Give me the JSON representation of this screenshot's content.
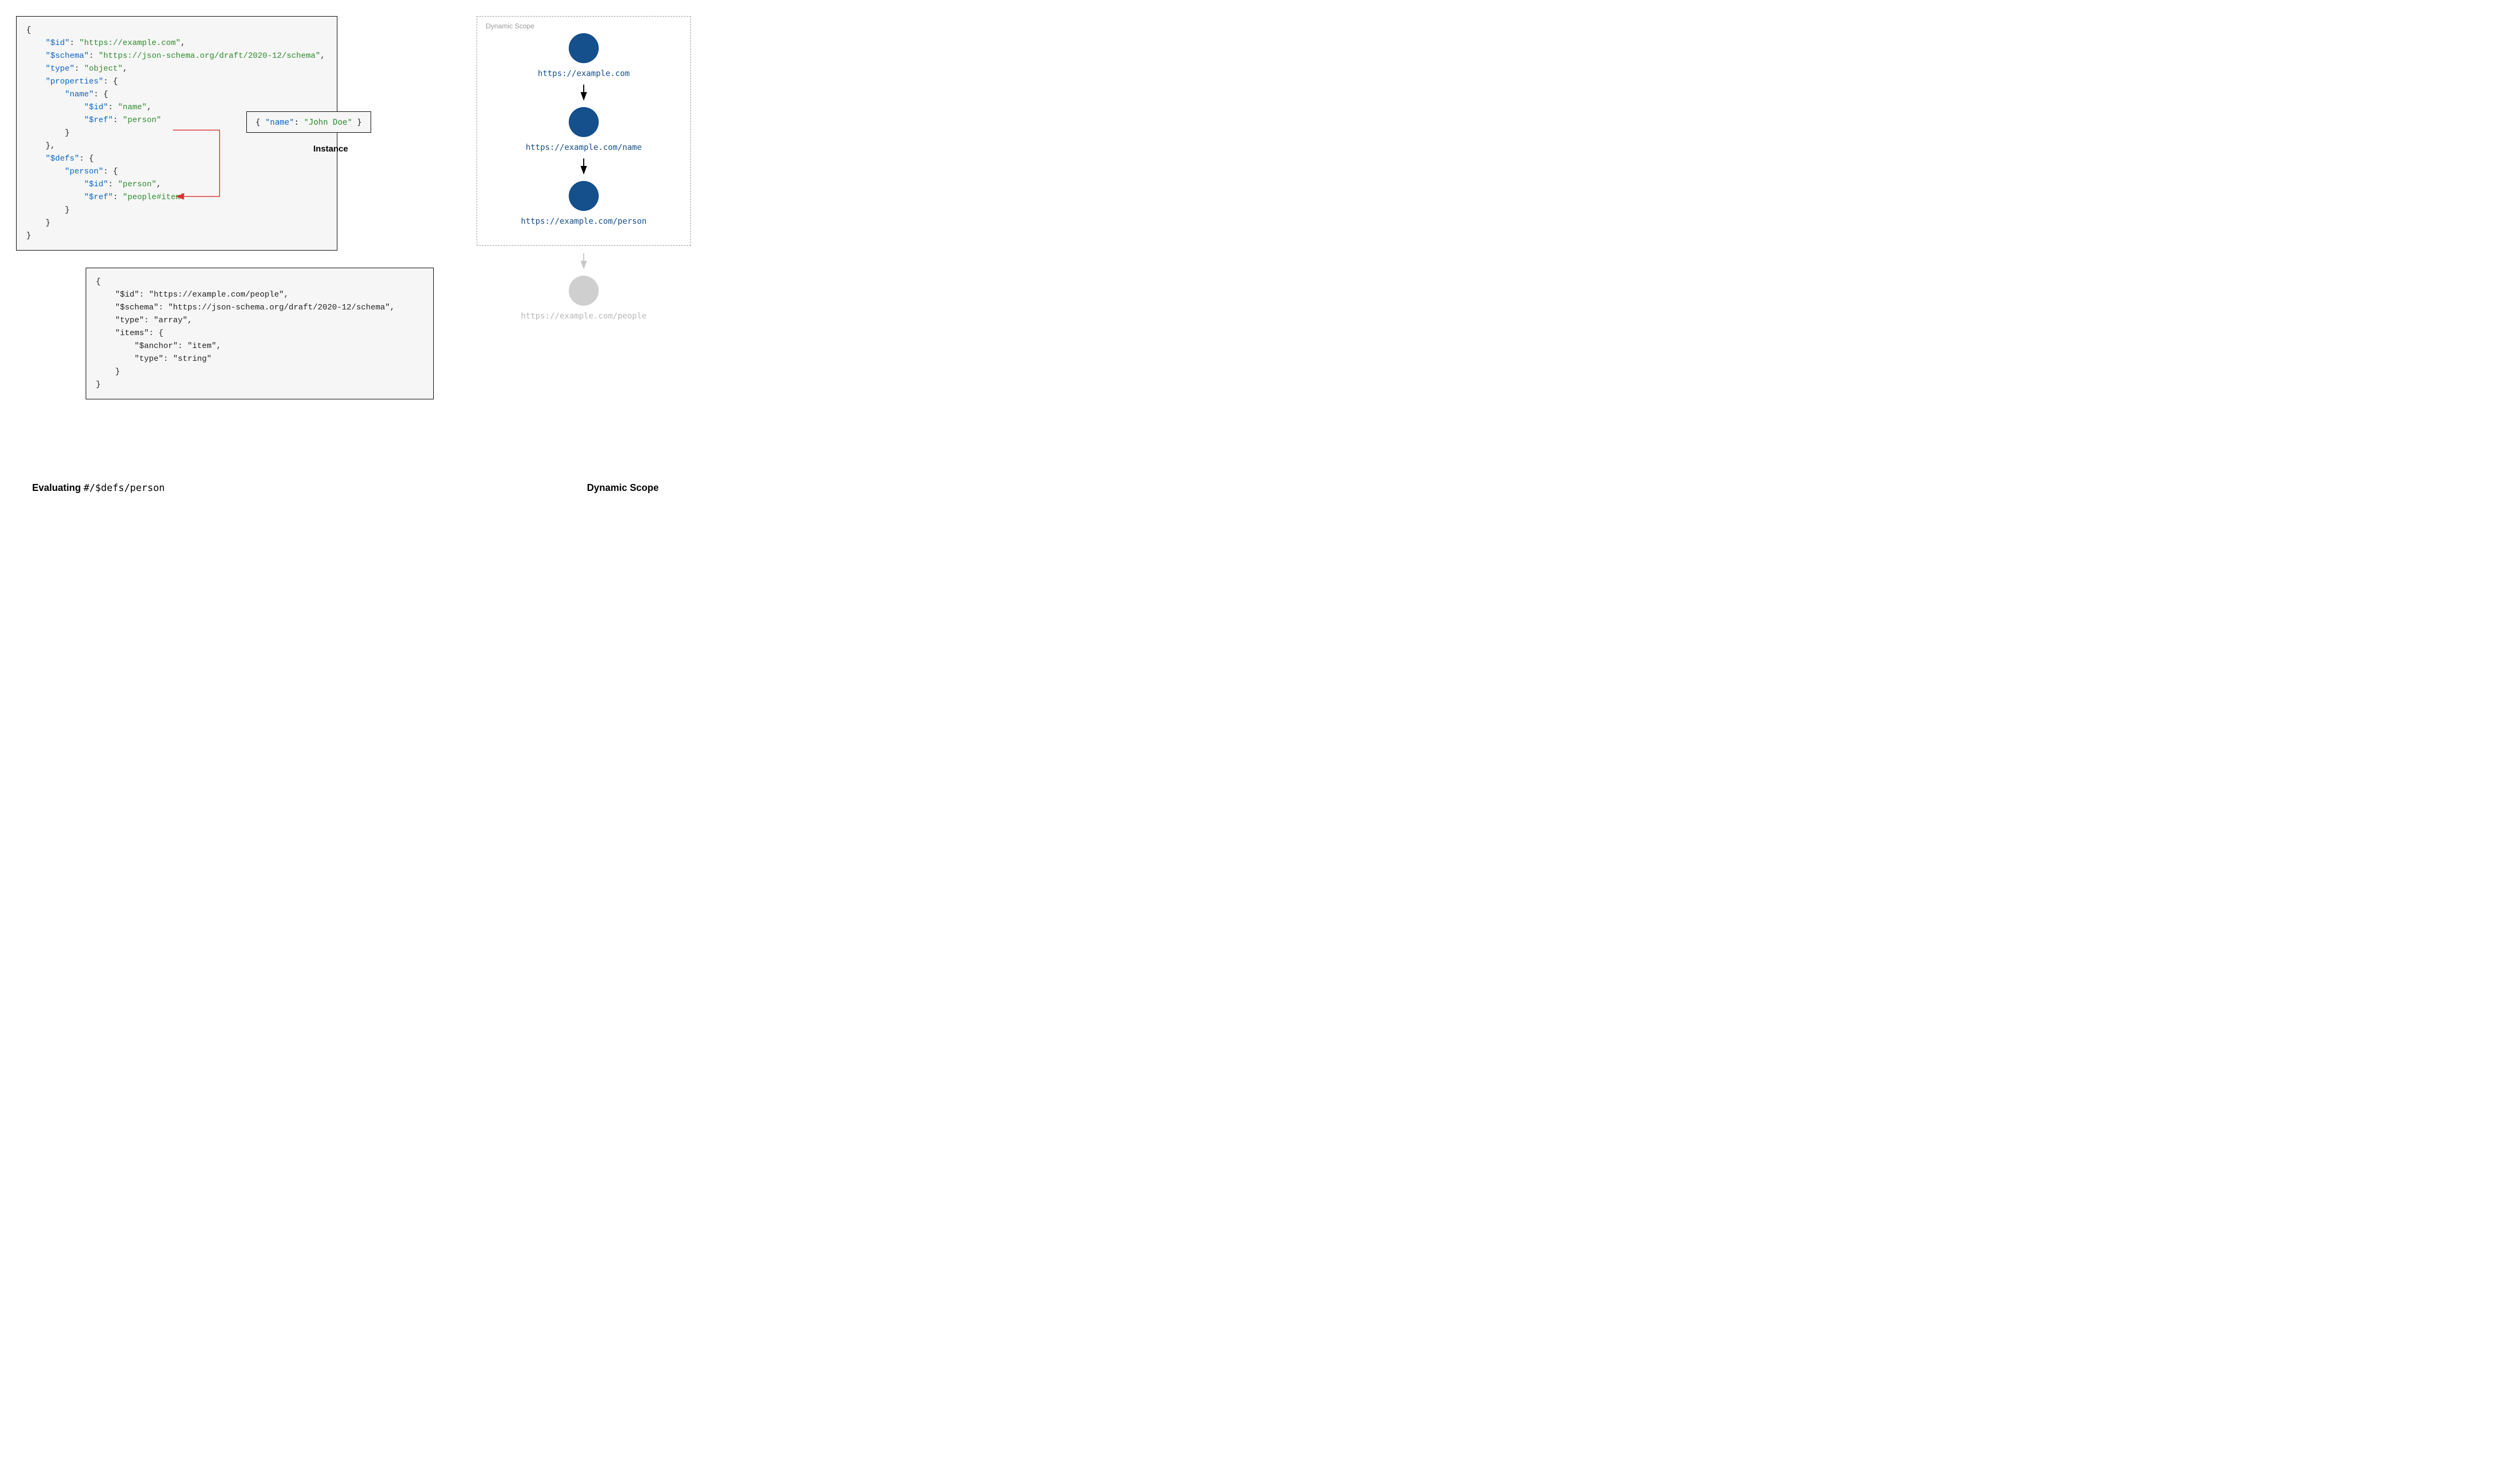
{
  "left": {
    "schema": {
      "lines": [
        [
          [
            "punct",
            "{"
          ]
        ],
        [
          [
            "punct",
            "    "
          ],
          [
            "key",
            "\"$id\""
          ],
          [
            "punct",
            ": "
          ],
          [
            "str",
            "\"https://example.com\""
          ],
          [
            "punct",
            ","
          ]
        ],
        [
          [
            "punct",
            "    "
          ],
          [
            "key",
            "\"$schema\""
          ],
          [
            "punct",
            ": "
          ],
          [
            "str",
            "\"https://json-schema.org/draft/2020-12/schema\""
          ],
          [
            "punct",
            ","
          ]
        ],
        [
          [
            "punct",
            "    "
          ],
          [
            "key",
            "\"type\""
          ],
          [
            "punct",
            ": "
          ],
          [
            "str",
            "\"object\""
          ],
          [
            "punct",
            ","
          ]
        ],
        [
          [
            "punct",
            "    "
          ],
          [
            "key",
            "\"properties\""
          ],
          [
            "punct",
            ": {"
          ]
        ],
        [
          [
            "punct",
            "        "
          ],
          [
            "key",
            "\"name\""
          ],
          [
            "punct",
            ": {"
          ]
        ],
        [
          [
            "punct",
            "            "
          ],
          [
            "key",
            "\"$id\""
          ],
          [
            "punct",
            ": "
          ],
          [
            "str",
            "\"name\""
          ],
          [
            "punct",
            ","
          ]
        ],
        [
          [
            "punct",
            "            "
          ],
          [
            "key",
            "\"$ref\""
          ],
          [
            "punct",
            ": "
          ],
          [
            "str",
            "\"person\""
          ]
        ],
        [
          [
            "punct",
            "        }"
          ]
        ],
        [
          [
            "punct",
            "    },"
          ]
        ],
        [
          [
            "punct",
            "    "
          ],
          [
            "key",
            "\"$defs\""
          ],
          [
            "punct",
            ": {"
          ]
        ],
        [
          [
            "punct",
            "        "
          ],
          [
            "key",
            "\"person\""
          ],
          [
            "punct",
            ": {"
          ]
        ],
        [
          [
            "punct",
            "            "
          ],
          [
            "key",
            "\"$id\""
          ],
          [
            "punct",
            ": "
          ],
          [
            "str",
            "\"person\""
          ],
          [
            "punct",
            ","
          ]
        ],
        [
          [
            "punct",
            "            "
          ],
          [
            "key",
            "\"$ref\""
          ],
          [
            "punct",
            ": "
          ],
          [
            "str",
            "\"people#item\""
          ]
        ],
        [
          [
            "punct",
            "        }"
          ]
        ],
        [
          [
            "punct",
            "    }"
          ]
        ],
        [
          [
            "punct",
            "}"
          ]
        ]
      ]
    },
    "instance": {
      "tokens": [
        [
          "punct",
          "{ "
        ],
        [
          "key",
          "\"name\""
        ],
        [
          "punct",
          ": "
        ],
        [
          "str",
          "\"John Doe\""
        ],
        [
          "punct",
          " }"
        ]
      ],
      "label": "Instance"
    },
    "people": {
      "lines": [
        [
          [
            "punct",
            "{"
          ]
        ],
        [
          [
            "punct",
            "    \"$id\": \"https://example.com/people\","
          ]
        ],
        [
          [
            "punct",
            "    \"$schema\": \"https://json-schema.org/draft/2020-12/schema\","
          ]
        ],
        [
          [
            "punct",
            "    \"type\": \"array\","
          ]
        ],
        [
          [
            "punct",
            "    \"items\": {"
          ]
        ],
        [
          [
            "punct",
            "        \"$anchor\": \"item\","
          ]
        ],
        [
          [
            "punct",
            "        \"type\": \"string\""
          ]
        ],
        [
          [
            "punct",
            "    }"
          ]
        ],
        [
          [
            "punct",
            "}"
          ]
        ]
      ]
    },
    "caption_bold": "Evaluating ",
    "caption_path": "#/$defs/person"
  },
  "right": {
    "scope_title": "Dynamic Scope",
    "nodes": [
      {
        "uri": "https://example.com",
        "color": "blue"
      },
      {
        "uri": "https://example.com/name",
        "color": "blue"
      },
      {
        "uri": "https://example.com/person",
        "color": "blue"
      }
    ],
    "outside": {
      "uri": "https://example.com/people",
      "color": "grey"
    },
    "caption": "Dynamic Scope"
  }
}
